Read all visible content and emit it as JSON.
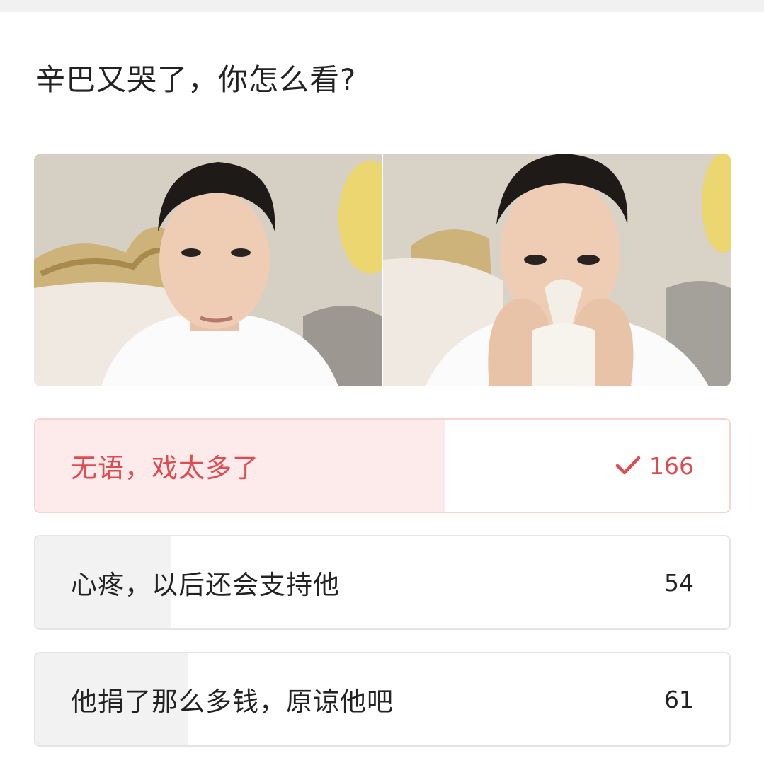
{
  "question": "辛巴又哭了，你怎么看?",
  "images": [
    {
      "icon": "man-speaking-photo"
    },
    {
      "icon": "man-crying-with-tissue-photo"
    }
  ],
  "options": [
    {
      "label": "无语，戏太多了",
      "count": "166",
      "selected": true,
      "fill": 0.59
    },
    {
      "label": "心疼，以后还会支持他",
      "count": "54",
      "selected": false,
      "fill": 0.19
    },
    {
      "label": "他捐了那么多钱，原谅他吧",
      "count": "61",
      "selected": false,
      "fill": 0.22
    }
  ],
  "colors": {
    "accent": "#e04b4f",
    "selected_fill": "#fdebec",
    "unselected_fill": "#f2f2f2",
    "border": "#e4e4e4"
  }
}
